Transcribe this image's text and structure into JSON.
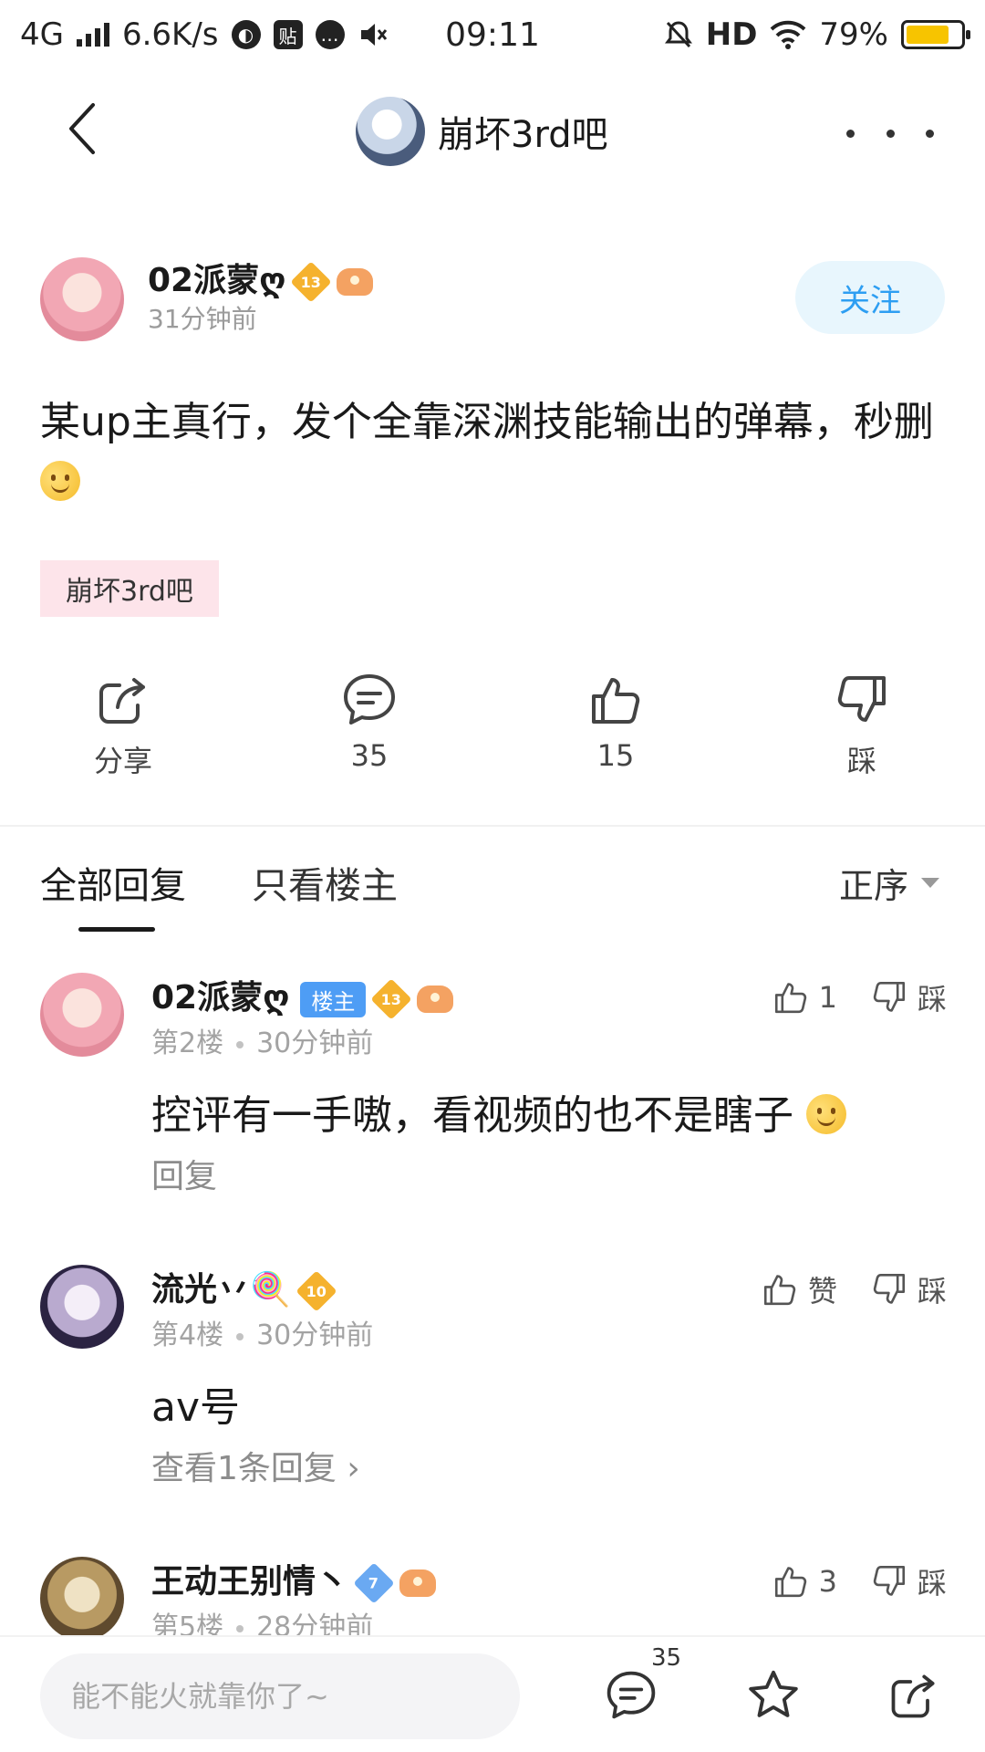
{
  "status_bar": {
    "network": "4G",
    "speed": "6.6K/s",
    "app_badge": "贴",
    "time": "09:11",
    "hd": "HD",
    "battery": "79%",
    "battery_level": 0.79
  },
  "header": {
    "title": "崩坏3rd吧"
  },
  "post": {
    "author": "02派蒙ღ",
    "author_level": "13",
    "time": "31分钟前",
    "follow_label": "关注",
    "content": "某up主真行，发个全靠深渊技能输出的弹幕，秒删",
    "tag": "崩坏3rd吧",
    "actions": {
      "share": "分享",
      "comments": "35",
      "likes": "15",
      "dislike": "踩"
    }
  },
  "tabs": {
    "all": "全部回复",
    "owner_only": "只看楼主",
    "sort": "正序"
  },
  "comments": [
    {
      "name": "02派蒙ღ",
      "owner_tag": "楼主",
      "level": "13",
      "floor": "第2楼",
      "time": "30分钟前",
      "text": "控评有一手嗷，看视频的也不是瞎子",
      "link": "回复",
      "likes": "1",
      "dislike": "踩"
    },
    {
      "name": "流光丷🍭",
      "level": "10",
      "floor": "第4楼",
      "time": "30分钟前",
      "text": "av号",
      "link": "查看1条回复 ›",
      "likes": "赞",
      "dislike": "踩"
    },
    {
      "name": "王动王别情丶",
      "level": "7",
      "floor": "第5楼",
      "time": "28分钟前",
      "likes": "3",
      "dislike": "踩"
    }
  ],
  "bottom_bar": {
    "reply_placeholder": "能不能火就靠你了~",
    "comment_count": "35"
  },
  "colors": {
    "accent": "#2d9ef2",
    "owner_tag": "#4e9df5",
    "tag_bg": "#fde4ea",
    "battery": "#f7c400"
  },
  "icons": [
    "back-icon",
    "more-icon",
    "share-icon",
    "comment-icon",
    "like-icon",
    "dislike-icon",
    "star-icon"
  ]
}
